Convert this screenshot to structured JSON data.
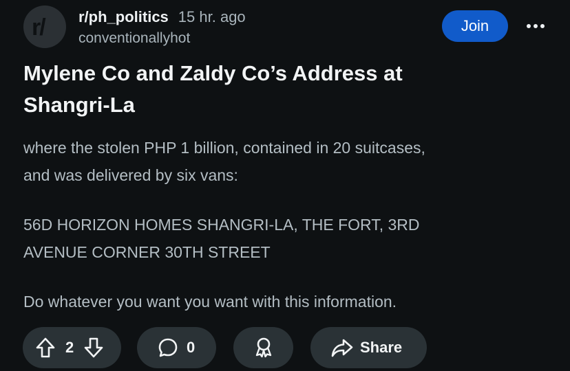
{
  "post": {
    "avatar_text": "r/",
    "subreddit": "r/ph_politics",
    "time": "15 hr. ago",
    "author": "conventionallyhot",
    "join_label": "Join",
    "title_line1": "Mylene Co and Zaldy Co’s Address at",
    "title_line2": "Shangri-La",
    "body": {
      "p1_line1": "where the stolen PHP 1 billion, contained in 20 suitcases,",
      "p1_line2": "and was delivered by six vans:",
      "p2_line1": "56D HORIZON HOMES SHANGRI-LA, THE FORT, 3RD",
      "p2_line2": "AVENUE CORNER 30TH STREET",
      "p3_line1": "Do whatever you want you want with this information."
    }
  },
  "actions": {
    "vote_count": "2",
    "comment_count": "0",
    "share_label": "Share"
  },
  "icons": {
    "more": "more-options-icon",
    "upvote": "upvote-arrow-icon",
    "downvote": "downvote-arrow-icon",
    "comment": "comment-bubble-icon",
    "award": "award-ribbon-icon",
    "share": "share-arrow-icon"
  },
  "colors": {
    "background": "#0e1113",
    "join_button": "#115bca",
    "pill_background": "#2a3236",
    "text_primary": "#f2f4f5",
    "text_secondary": "#b4bec4"
  }
}
